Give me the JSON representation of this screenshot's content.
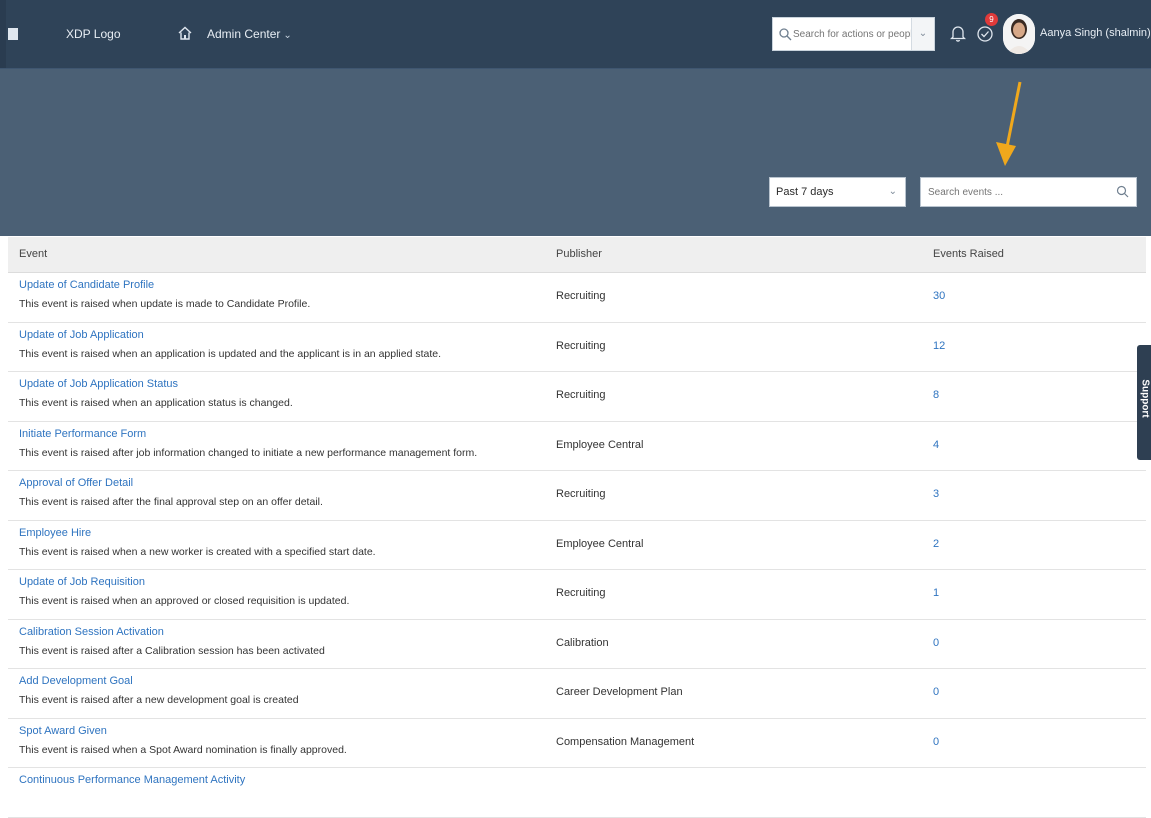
{
  "shell": {
    "app_title": "XDP Logo",
    "admin_menu": "Admin Center",
    "search_placeholder": "Search for actions or people",
    "notification_count": "9",
    "user_name": "Aanya Singh (shalmin)"
  },
  "header": {
    "breadcrumb": "",
    "page_title": "",
    "section_title": "",
    "export_label": "",
    "range_value": "Past 7 days",
    "events_search_placeholder": "Search events ..."
  },
  "table": {
    "columns": [
      "Event",
      "Publisher",
      "Events Raised"
    ],
    "rows": [
      {
        "event": "Update of Candidate Profile",
        "description": "This event is raised when update is made to Candidate Profile.",
        "publisher": "Recruiting",
        "count": "30"
      },
      {
        "event": "Update of Job Application",
        "description": "This event is raised when an application is updated and the applicant is in an applied state.",
        "publisher": "Recruiting",
        "count": "12"
      },
      {
        "event": "Update of Job Application Status",
        "description": "This event is raised when an application status is changed.",
        "publisher": "Recruiting",
        "count": "8"
      },
      {
        "event": "Initiate Performance Form",
        "description": "This event is raised after job information changed to initiate a new performance management form.",
        "publisher": "Employee Central",
        "count": "4"
      },
      {
        "event": "Approval of Offer Detail",
        "description": "This event is raised after the final approval step on an offer detail.",
        "publisher": "Recruiting",
        "count": "3"
      },
      {
        "event": "Employee Hire",
        "description": "This event is raised when a new worker is created with a specified start date.",
        "publisher": "Employee Central",
        "count": "2"
      },
      {
        "event": "Update of Job Requisition",
        "description": "This event is raised when an approved or closed requisition is updated.",
        "publisher": "Recruiting",
        "count": "1"
      },
      {
        "event": "Calibration Session Activation",
        "description": "This event is raised after a Calibration session has been activated",
        "publisher": "Calibration",
        "count": "0"
      },
      {
        "event": "Add Development Goal",
        "description": "This event is raised after a new development goal is created",
        "publisher": "Career Development Plan",
        "count": "0"
      },
      {
        "event": "Spot Award Given",
        "description": "This event is raised when a Spot Award nomination is finally approved.",
        "publisher": "Compensation Management",
        "count": "0"
      },
      {
        "event": "Continuous Performance Management Activity",
        "description": "",
        "publisher": "",
        "count": ""
      }
    ]
  },
  "support_label": "Support",
  "colors": {
    "shell_bg": "#2f4358",
    "header_bg": "#4b6075",
    "link": "#2f74c0",
    "annotation_arrow": "#f0a81c"
  }
}
